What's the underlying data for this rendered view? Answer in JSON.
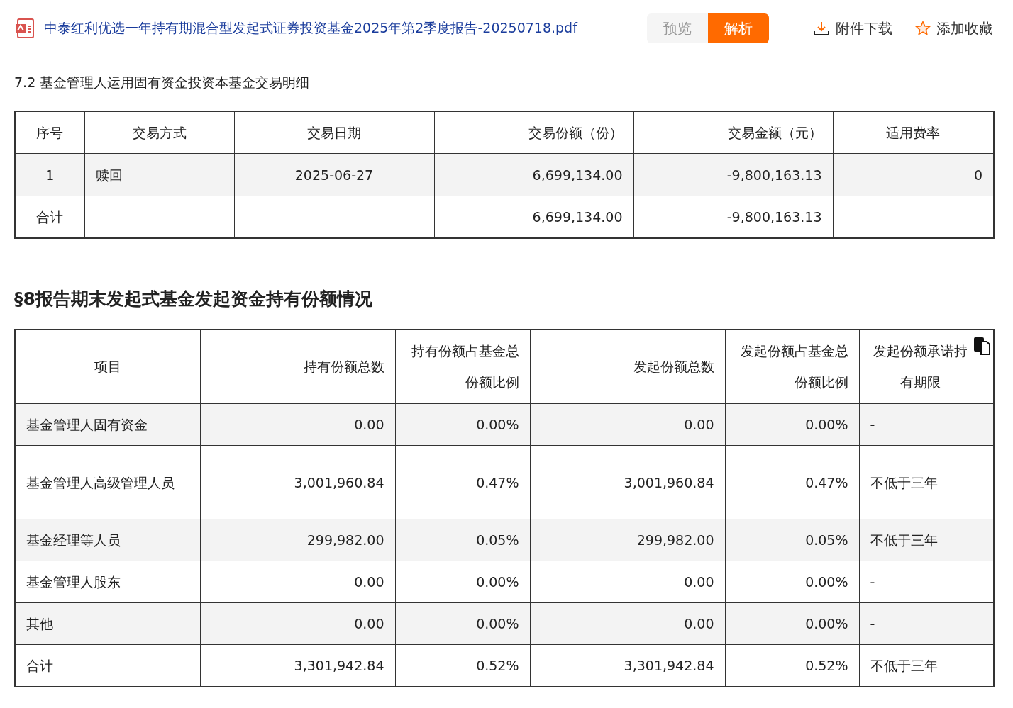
{
  "header": {
    "file_name": "中泰红利优选一年持有期混合型发起式证券投资基金2025年第2季度报告-20250718.pdf",
    "view_tabs": [
      {
        "label": "预览",
        "selected": false
      },
      {
        "label": "解析",
        "selected": true
      }
    ],
    "download": "附件下载",
    "favorite": "添加收藏"
  },
  "section_7_2": {
    "title": "7.2 基金管理人运用固有资金投资本基金交易明细",
    "columns": [
      "序号",
      "交易方式",
      "交易日期",
      "交易份额（份）",
      "交易金额（元）",
      "适用费率"
    ],
    "rows": [
      [
        "1",
        "赎回",
        "2025-06-27",
        "6,699,134.00",
        "-9,800,163.13",
        "0"
      ],
      [
        "合计",
        "",
        "",
        "6,699,134.00",
        "-9,800,163.13",
        ""
      ]
    ]
  },
  "section_8": {
    "title": "§8报告期末发起式基金发起资金持有份额情况",
    "columns": [
      "项目",
      "持有份额总数",
      "持有份额占基金总份额比例",
      "发起份额总数",
      "发起份额占基金总份额比例",
      "发起份额承诺持有期限"
    ],
    "rows": [
      [
        "基金管理人固有资金",
        "0.00",
        "0.00%",
        "0.00",
        "0.00%",
        "-"
      ],
      [
        "基金管理人高级管理人员",
        "3,001,960.84",
        "0.47%",
        "3,001,960.84",
        "0.47%",
        "不低于三年"
      ],
      [
        "基金经理等人员",
        "299,982.00",
        "0.05%",
        "299,982.00",
        "0.05%",
        "不低于三年"
      ],
      [
        "基金管理人股东",
        "0.00",
        "0.00%",
        "0.00",
        "0.00%",
        "-"
      ],
      [
        "其他",
        "0.00",
        "0.00%",
        "0.00",
        "0.00%",
        "-"
      ],
      [
        "合计",
        "3,301,942.84",
        "0.52%",
        "3,301,942.84",
        "0.52%",
        "不低于三年"
      ]
    ]
  }
}
